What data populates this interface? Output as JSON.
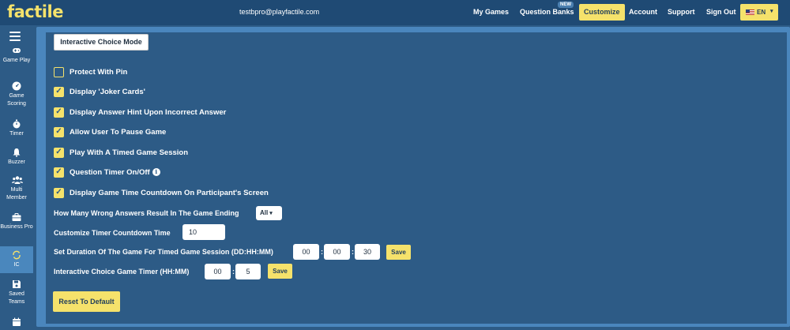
{
  "header": {
    "logo": "factile",
    "email": "testbpro@playfactile.com",
    "nav": {
      "my_games": "My Games",
      "question_banks": "Question Banks",
      "new_badge": "NEW",
      "customize": "Customize",
      "account": "Account",
      "support": "Support",
      "sign_out": "Sign Out"
    },
    "language": "EN"
  },
  "sidebar": {
    "items": [
      {
        "label": "Game Play",
        "icon": "gamepad-icon"
      },
      {
        "label": "Game Scoring",
        "icon": "gauge-icon"
      },
      {
        "label": "Timer",
        "icon": "stopwatch-icon"
      },
      {
        "label": "Buzzer",
        "icon": "bell-icon"
      },
      {
        "label": "Multi Member",
        "icon": "users-icon"
      },
      {
        "label": "Business Pro",
        "icon": "briefcase-icon"
      },
      {
        "label": "IC",
        "icon": "refresh-icon",
        "active": true
      },
      {
        "label": "Saved Teams",
        "icon": "save-icon"
      },
      {
        "label": "",
        "icon": "calendar-icon"
      }
    ]
  },
  "main": {
    "mode_button": "Interactive Choice Mode",
    "options": [
      {
        "label": "Protect With Pin",
        "checked": false
      },
      {
        "label": "Display 'Joker Cards'",
        "checked": true
      },
      {
        "label": "Display Answer Hint Upon Incorrect Answer",
        "checked": true
      },
      {
        "label": "Allow User To Pause Game",
        "checked": true
      },
      {
        "label": "Play With A Timed Game Session",
        "checked": true
      },
      {
        "label": "Question Timer On/Off",
        "checked": true
      },
      {
        "label": "Display Game Time Countdown On Participant's Screen",
        "checked": true
      }
    ],
    "wrong_answers": {
      "label": "How Many Wrong Answers Result In The Game Ending",
      "value": "All"
    },
    "timer_countdown": {
      "label": "Customize Timer Countdown Time",
      "value": "10"
    },
    "duration": {
      "label": "Set Duration Of The Game For Timed Game Session (DD:HH:MM)",
      "dd": "00",
      "hh": "00",
      "mm": "30",
      "save": "Save"
    },
    "ic_timer": {
      "label": "Interactive Choice Game Timer (HH:MM)",
      "hh": "00",
      "mm": "5",
      "save": "Save"
    },
    "reset": "Reset To Default"
  },
  "colors": {
    "accent": "#f5e26b",
    "background": "#2d5b86",
    "header": "#1f4a74",
    "panel_border": "#4a86bd"
  }
}
